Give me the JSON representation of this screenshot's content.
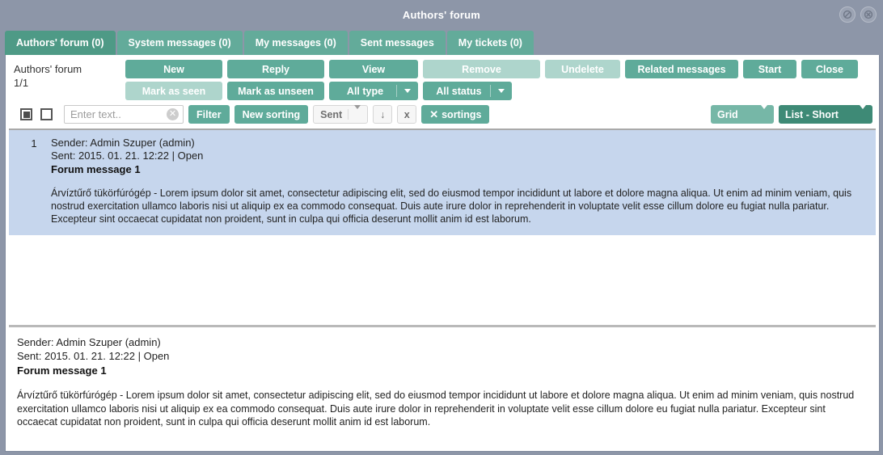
{
  "window": {
    "title": "Authors' forum",
    "icons": [
      {
        "name": "block-icon",
        "glyph": "⦸"
      },
      {
        "name": "close-icon",
        "glyph": "✕"
      }
    ]
  },
  "tabs": [
    {
      "label": "Authors' forum (0)",
      "active": true
    },
    {
      "label": "System messages (0)",
      "active": false
    },
    {
      "label": "My messages (0)",
      "active": false
    },
    {
      "label": "Sent messages",
      "active": false
    },
    {
      "label": "My tickets (0)",
      "active": false
    }
  ],
  "context": {
    "title": "Authors' forum",
    "page_indicator": "1/1"
  },
  "toolbar": {
    "row1": [
      {
        "label": "New",
        "disabled": false
      },
      {
        "label": "Reply",
        "disabled": false
      },
      {
        "label": "View",
        "disabled": false
      },
      {
        "label": "Remove",
        "disabled": true
      },
      {
        "label": "Undelete",
        "disabled": true
      },
      {
        "label": "Related messages",
        "disabled": false
      },
      {
        "label": "Start",
        "disabled": false
      },
      {
        "label": "Close",
        "disabled": false
      }
    ],
    "row2": [
      {
        "label": "Mark as seen",
        "disabled": true
      },
      {
        "label": "Mark as unseen",
        "disabled": false
      },
      {
        "label": "All type",
        "disabled": false,
        "dropdown": true
      },
      {
        "label": "All status",
        "disabled": false,
        "dropdown": true
      }
    ]
  },
  "filterbar": {
    "select_all_checkbox": "select-all",
    "second_checkbox": "invert-selection",
    "search_placeholder": "Enter text..",
    "search_value": "",
    "clear_glyph": "✕",
    "filter_label": "Filter",
    "new_sorting_label": "New sorting",
    "sort_field_label": "Sent",
    "sort_direction_glyph": "↓",
    "sort_remove_glyph": "x",
    "clear_sortings_label": "sortings",
    "clear_sortings_glyph": "✕",
    "view_grid_label": "Grid",
    "view_list_label": "List - Short"
  },
  "messages": [
    {
      "index": "1",
      "sender": "Sender: Admin Szuper (admin)",
      "sent": "Sent: 2015. 01. 21. 12:22 | Open",
      "subject": "Forum message 1",
      "body": "Árvíztűrő tükörfúrógép - Lorem ipsum dolor sit amet, consectetur adipiscing elit, sed do eiusmod tempor incididunt ut labore et dolore magna aliqua. Ut enim ad minim veniam, quis nostrud exercitation ullamco laboris nisi ut aliquip ex ea commodo consequat. Duis aute irure dolor in reprehenderit in voluptate velit esse cillum dolore eu fugiat nulla pariatur. Excepteur sint occaecat cupidatat non proident, sunt in culpa qui officia deserunt mollit anim id est laborum."
    }
  ],
  "detail": {
    "sender": "Sender: Admin Szuper (admin)",
    "sent": "Sent: 2015. 01. 21. 12:22 | Open",
    "subject": "Forum message 1",
    "body": "Árvíztűrő tükörfúrógép - Lorem ipsum dolor sit amet, consectetur adipiscing elit, sed do eiusmod tempor incididunt ut labore et dolore magna aliqua. Ut enim ad minim veniam, quis nostrud exercitation ullamco laboris nisi ut aliquip ex ea commodo consequat. Duis aute irure dolor in reprehenderit in voluptate velit esse cillum dolore eu fugiat nulla pariatur. Excepteur sint occaecat cupidatat non proident, sunt in culpa qui officia deserunt mollit anim id est laborum."
  },
  "colors": {
    "chrome": "#8d96a8",
    "accent_green": "#5fab9a",
    "accent_green_dark": "#4e9a86",
    "accent_green_light": "#aed5cc",
    "selected_row": "#c6d6ed"
  }
}
